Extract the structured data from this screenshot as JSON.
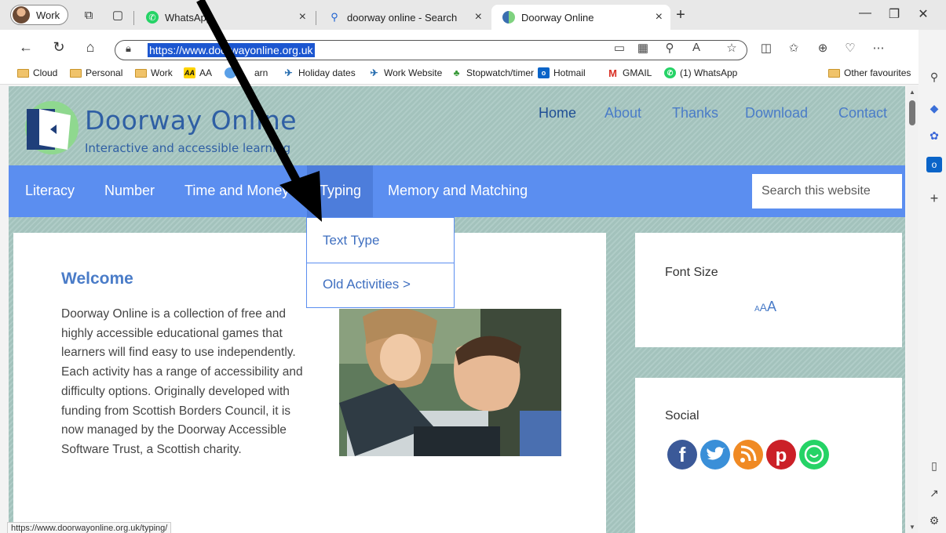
{
  "browser": {
    "profile_label": "Work",
    "tabs": [
      {
        "title": "WhatsApp",
        "close": "×"
      },
      {
        "title": "doorway online - Search",
        "close": "×"
      },
      {
        "title": "Doorway Online",
        "close": "×"
      }
    ],
    "new_tab": "+",
    "url": "https://www.doorwayonline.org.uk",
    "bookmarks": [
      {
        "label": "Cloud",
        "icon": "folder"
      },
      {
        "label": "Personal",
        "icon": "folder"
      },
      {
        "label": "Work",
        "icon": "folder"
      },
      {
        "label": "AA",
        "icon": "aa-logo"
      },
      {
        "label": "arn",
        "icon": "blue-circle"
      },
      {
        "label": "Holiday dates",
        "icon": "bird"
      },
      {
        "label": "Work Website",
        "icon": "bird"
      },
      {
        "label": "Stopwatch/timer",
        "icon": "timer"
      },
      {
        "label": "Hotmail",
        "icon": "outlook"
      },
      {
        "label": "GMAIL",
        "icon": "gmail"
      },
      {
        "label": "(1) WhatsApp",
        "icon": "whatsapp"
      }
    ],
    "other_favourites": "Other favourites",
    "status_url": "https://www.doorwayonline.org.uk/typing/"
  },
  "site": {
    "title": "Doorway Online",
    "tagline": "Interactive and accessible learning",
    "top_nav": [
      "Home",
      "About",
      "Thanks",
      "Download",
      "Contact"
    ],
    "main_nav": [
      "Literacy",
      "Number",
      "Time and Money",
      "Typing",
      "Memory and Matching"
    ],
    "search_placeholder": "Search this website",
    "dropdown": [
      "Text Type",
      "Old Activities >"
    ],
    "welcome_title": "Welcome",
    "welcome_lines": [
      "Doorway Online is a collection of free and",
      "highly accessible educational games that",
      "learners will find easy to use independently.",
      "Each activity has a range of accessibility and",
      "difficulty options. Originally developed with",
      "funding from Scottish Borders Council, it is",
      "now managed by the Doorway Accessible",
      "Software Trust, a Scottish charity."
    ],
    "font_size_label": "Font Size",
    "font_size_control": [
      "A",
      "A",
      "A"
    ],
    "social_label": "Social",
    "social_icons": [
      "facebook-icon",
      "twitter-icon",
      "rss-icon",
      "pinterest-icon",
      "whatsapp-icon"
    ]
  },
  "colors": {
    "nav_blue": "#5b8ef0",
    "link_blue": "#4a7cc8",
    "site_background": "#a8c8c2"
  }
}
